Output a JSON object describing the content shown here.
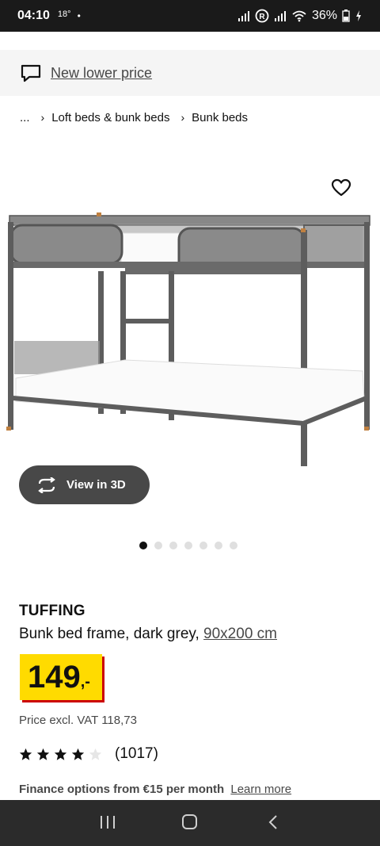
{
  "status_bar": {
    "time": "04:10",
    "temp": "18°",
    "dot": "•",
    "battery": "36%"
  },
  "promo": {
    "icon": "chat-bubble-icon",
    "text": "New lower price"
  },
  "breadcrumb": {
    "ellipsis": "...",
    "separator": "›",
    "items": [
      "Loft beds & bunk beds",
      "Bunk beds"
    ]
  },
  "product": {
    "view_3d_label": "View in 3D",
    "image_count": 7,
    "active_image": 0,
    "brand": "TUFFING",
    "description": "Bunk bed frame, dark grey,",
    "size": "90x200 cm",
    "price_integer": "149",
    "price_decimal": ",-",
    "price_excl_vat": "Price excl. VAT 118,73",
    "rating": 4,
    "rating_max": 5,
    "review_count": "(1017)",
    "finance_text": "Finance options from €15 per month",
    "finance_link": "Learn more"
  },
  "colors": {
    "price_yellow": "#ffdb00",
    "price_red": "#cc0008",
    "button_dark": "#484848"
  }
}
